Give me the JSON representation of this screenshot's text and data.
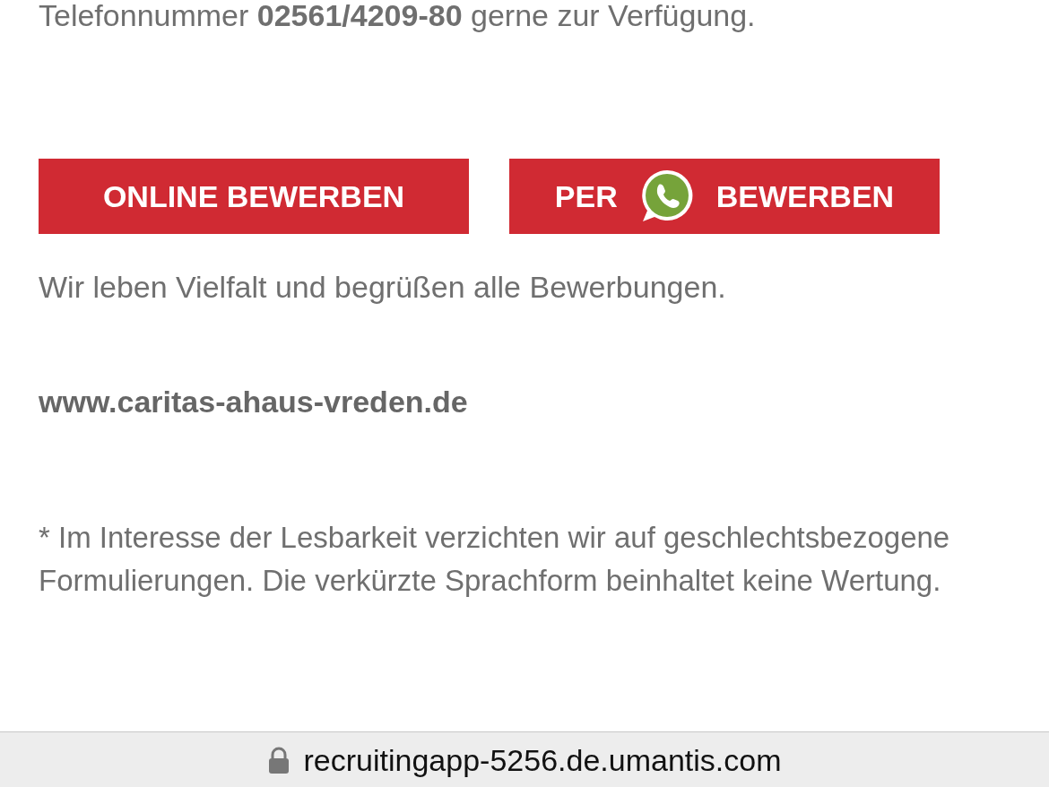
{
  "intro": "Telefonnummer **02561/4209-80** gerne zur Verfügung.",
  "buttons": [
    {
      "kind": "text",
      "label": "ONLINE BEWERBEN"
    },
    {
      "kind": "whatsapp",
      "label_before": "PER",
      "label_after": "BEWERBEN"
    }
  ],
  "diversity": "Wir leben Vielfalt und begrüßen alle Bewerbungen.",
  "website": "www.caritas-ahaus-vreden.de",
  "footnote": "* Im Interesse der Lesbarkeit verzichten wir auf geschlechtsbezogene Formulierungen. Die verkürzte Sprachform beinhaltet keine Wertung.",
  "address_bar": {
    "url": "recruitingapp-5256.de.umantis.com"
  }
}
